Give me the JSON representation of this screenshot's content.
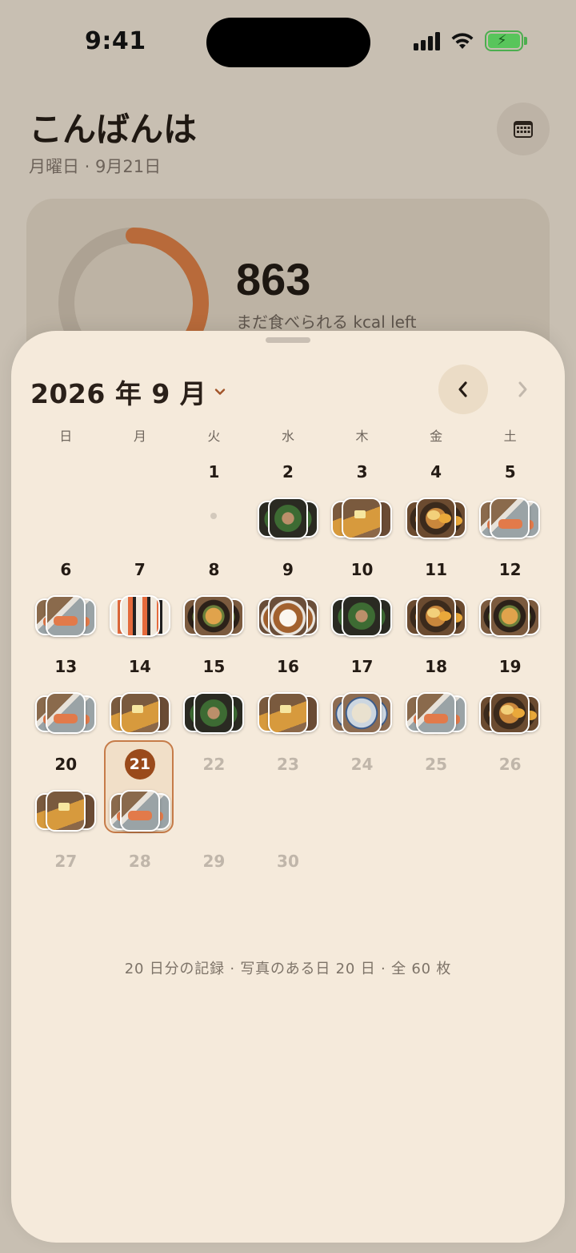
{
  "status_bar": {
    "time": "9:41"
  },
  "header": {
    "greeting": "こんばんは",
    "date_line": "月曜日 · 9月21日",
    "calendar_button_icon": "calendar-icon"
  },
  "summary": {
    "kcal_value": "863",
    "kcal_label": "まだ食べられる kcal left",
    "progress_ring_fraction": 0.33,
    "ring_color": "#b86a3a"
  },
  "calendar": {
    "month_label": "2026 年 9 月",
    "prev_icon": "chevron-left-icon",
    "next_icon": "chevron-right-icon",
    "weekdays": [
      "日",
      "月",
      "火",
      "水",
      "木",
      "金",
      "土"
    ],
    "selected_day": 21,
    "accent_color": "#9a4a1b",
    "days": [
      {
        "day": "",
        "state": "empty"
      },
      {
        "day": "",
        "state": "empty"
      },
      {
        "day": "1",
        "state": "no-record"
      },
      {
        "day": "2",
        "state": "photos",
        "photos": [
          "f-greens",
          "f-greens",
          "f-greens"
        ]
      },
      {
        "day": "3",
        "state": "photos",
        "photos": [
          "f-toast",
          "f-latte",
          "f-toast"
        ]
      },
      {
        "day": "4",
        "state": "photos",
        "photos": [
          "f-ramen",
          "f-ramen",
          "f-ramen"
        ]
      },
      {
        "day": "5",
        "state": "photos",
        "photos": [
          "f-salmon",
          "f-salmon",
          "f-salmon"
        ]
      },
      {
        "day": "6",
        "state": "photos",
        "photos": [
          "f-salmon",
          "f-salmon",
          "f-salmon"
        ]
      },
      {
        "day": "7",
        "state": "photos",
        "photos": [
          "f-sushi",
          "f-sushi",
          "f-sushi"
        ]
      },
      {
        "day": "8",
        "state": "photos",
        "photos": [
          "f-donburi",
          "f-donburi",
          "f-donburi"
        ]
      },
      {
        "day": "9",
        "state": "photos",
        "photos": [
          "f-curry",
          "f-curry",
          "f-curry"
        ]
      },
      {
        "day": "10",
        "state": "photos",
        "photos": [
          "f-greens",
          "f-greens",
          "f-greens"
        ]
      },
      {
        "day": "11",
        "state": "photos",
        "photos": [
          "f-ramen",
          "f-ramen",
          "f-ramen"
        ]
      },
      {
        "day": "12",
        "state": "photos",
        "photos": [
          "f-donburi",
          "f-donburi",
          "f-donburi"
        ]
      },
      {
        "day": "13",
        "state": "photos",
        "photos": [
          "f-salmon",
          "f-salmon",
          "f-salmon"
        ]
      },
      {
        "day": "14",
        "state": "photos",
        "photos": [
          "f-toast",
          "f-latte",
          "f-toast"
        ]
      },
      {
        "day": "15",
        "state": "photos",
        "photos": [
          "f-greens",
          "f-greens",
          "f-greens"
        ]
      },
      {
        "day": "16",
        "state": "photos",
        "photos": [
          "f-toast",
          "f-latte",
          "f-toast"
        ]
      },
      {
        "day": "17",
        "state": "photos",
        "photos": [
          "f-noodle",
          "f-noodle",
          "f-noodle"
        ]
      },
      {
        "day": "18",
        "state": "photos",
        "photos": [
          "f-salmon",
          "f-salmon",
          "f-salmon"
        ]
      },
      {
        "day": "19",
        "state": "photos",
        "photos": [
          "f-ramen",
          "f-ramen",
          "f-ramen"
        ]
      },
      {
        "day": "20",
        "state": "photos",
        "photos": [
          "f-toast",
          "f-latte",
          "f-toast"
        ]
      },
      {
        "day": "21",
        "state": "selected",
        "photos": [
          "f-salmon",
          "f-salmon",
          "f-salmon"
        ]
      },
      {
        "day": "22",
        "state": "future"
      },
      {
        "day": "23",
        "state": "future"
      },
      {
        "day": "24",
        "state": "future"
      },
      {
        "day": "25",
        "state": "future"
      },
      {
        "day": "26",
        "state": "future"
      },
      {
        "day": "27",
        "state": "future"
      },
      {
        "day": "28",
        "state": "future"
      },
      {
        "day": "29",
        "state": "future"
      },
      {
        "day": "30",
        "state": "future"
      }
    ],
    "footer_note": "20 日分の記録 · 写真のある日 20 日 · 全 60 枚"
  }
}
